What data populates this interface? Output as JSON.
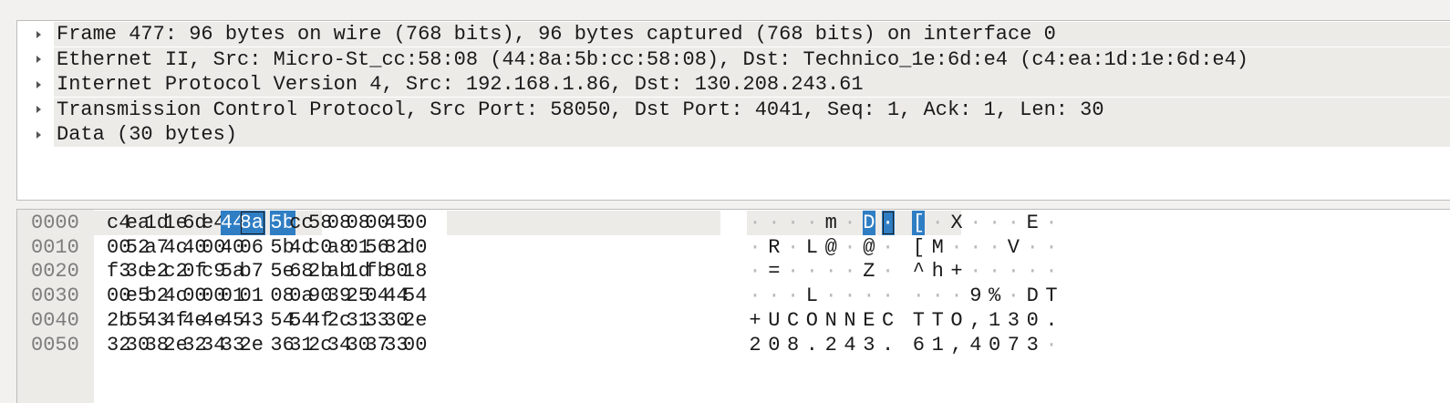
{
  "packet_tree": [
    {
      "label": "Frame 477: 96 bytes on wire (768 bits), 96 bytes captured (768 bits) on interface 0",
      "icon": "triangle-right-icon"
    },
    {
      "label": "Ethernet II, Src: Micro-St_cc:58:08 (44:8a:5b:cc:58:08), Dst: Technico_1e:6d:e4 (c4:ea:1d:1e:6d:e4)",
      "icon": "triangle-right-icon"
    },
    {
      "label": "Internet Protocol Version 4, Src: 192.168.1.86, Dst: 130.208.243.61",
      "icon": "triangle-right-icon"
    },
    {
      "label": "Transmission Control Protocol, Src Port: 58050, Dst Port: 4041, Seq: 1, Ack: 1, Len: 30",
      "icon": "triangle-right-icon"
    },
    {
      "label": "Data (30 bytes)",
      "icon": "triangle-right-icon"
    }
  ],
  "hex_dump": [
    {
      "offset": "0000",
      "bytes": [
        "c4",
        "ea",
        "1d",
        "1e",
        "6d",
        "e4",
        "44",
        "8a",
        "5b",
        "cc",
        "58",
        "08",
        "08",
        "00",
        "45",
        "00"
      ],
      "ascii": "····m·D· [·X···E·"
    },
    {
      "offset": "0010",
      "bytes": [
        "00",
        "52",
        "a7",
        "4c",
        "40",
        "00",
        "40",
        "06",
        "5b",
        "4d",
        "c0",
        "a8",
        "01",
        "56",
        "82",
        "d0"
      ],
      "ascii": "·R·L@·@· [M···V··"
    },
    {
      "offset": "0020",
      "bytes": [
        "f3",
        "3d",
        "e2",
        "c2",
        "0f",
        "c9",
        "5a",
        "b7",
        "5e",
        "68",
        "2b",
        "ab",
        "1d",
        "fb",
        "80",
        "18"
      ],
      "ascii": "·=····Z· ^h+·····"
    },
    {
      "offset": "0030",
      "bytes": [
        "00",
        "e5",
        "b2",
        "4c",
        "00",
        "00",
        "01",
        "01",
        "08",
        "0a",
        "90",
        "39",
        "25",
        "04",
        "44",
        "54"
      ],
      "ascii": "···L···· ···9%·DT"
    },
    {
      "offset": "0040",
      "bytes": [
        "2b",
        "55",
        "43",
        "4f",
        "4e",
        "4e",
        "45",
        "43",
        "54",
        "54",
        "4f",
        "2c",
        "31",
        "33",
        "30",
        "2e"
      ],
      "ascii": "+UCONNEC TTO,130."
    },
    {
      "offset": "0050",
      "bytes": [
        "32",
        "30",
        "38",
        "2e",
        "32",
        "34",
        "33",
        "2e",
        "36",
        "31",
        "2c",
        "34",
        "30",
        "37",
        "33",
        "00"
      ],
      "ascii": "208.243. 61,4073·"
    }
  ],
  "selection": {
    "row": 0,
    "byte_start": 6,
    "byte_end": 8,
    "cursor_byte": 7
  },
  "colors": {
    "selection": "#2f7ec4",
    "tree_row_bg": "#edebe8",
    "offset_text": "#7d7d7d"
  }
}
